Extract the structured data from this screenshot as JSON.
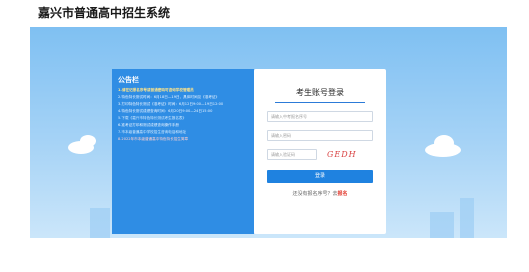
{
  "header": {
    "site_title": "嘉兴市普通高中招生系统"
  },
  "notice": {
    "title": "公告栏",
    "items": [
      {
        "text": "1.请在记报名序号或普通密码可咨询学校管理员",
        "style": "hl"
      },
      {
        "text": "2.特色特长测试时间：6月18日—19日，具体时间见《准考证》",
        "style": ""
      },
      {
        "text": "3.打印特色特长测试《准考证》时间：6月12日9:00—19日12:00",
        "style": ""
      },
      {
        "text": "4.特色特长测试成绩查询时间：6月20日9:00—24日15:00",
        "style": ""
      },
      {
        "text": "5.下载《嘉兴市特色特长测试考生报名表》",
        "style": "blue"
      },
      {
        "text": "6.准考证打印和测试成绩查询操作手册",
        "style": ""
      },
      {
        "text": "7.市本级普通高中学校招生咨询电话和地址",
        "style": "blue"
      },
      {
        "text": "8.2022年市本级普通高中特色特长招生简章",
        "style": "red"
      }
    ]
  },
  "login": {
    "title": "考生账号登录",
    "exam_no_placeholder": "请输入中考报名序号",
    "password_placeholder": "请输入密码",
    "captcha_placeholder": "请输入验证码",
    "captcha_text": "GEDH",
    "submit_label": "登录",
    "forgot_text": "还没有报名序号？去",
    "register_link": "报名"
  },
  "colors": {
    "accent": "#1f82e0",
    "notice_bg": "#2f8de4",
    "link_red": "#e23a2e"
  }
}
